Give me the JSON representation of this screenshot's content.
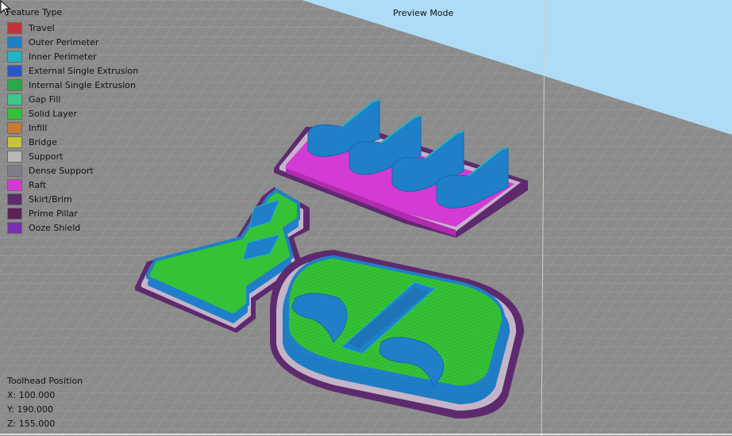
{
  "legend": {
    "title": "Feature Type",
    "items": [
      {
        "label": "Travel",
        "color": "#c2343a"
      },
      {
        "label": "Outer Perimeter",
        "color": "#1f80c9"
      },
      {
        "label": "Inner Perimeter",
        "color": "#22b3c4"
      },
      {
        "label": "External Single Extrusion",
        "color": "#2a57c8"
      },
      {
        "label": "Internal Single Extrusion",
        "color": "#2aa84a"
      },
      {
        "label": "Gap Fill",
        "color": "#3cc98e"
      },
      {
        "label": "Solid Layer",
        "color": "#35c236"
      },
      {
        "label": "Infill",
        "color": "#c57b36"
      },
      {
        "label": "Bridge",
        "color": "#c8c23a"
      },
      {
        "label": "Support",
        "color": "#b8b8b8"
      },
      {
        "label": "Dense Support",
        "color": "#7c7f83"
      },
      {
        "label": "Raft",
        "color": "#d43ad6"
      },
      {
        "label": "Skirt/Brim",
        "color": "#5e2a6e"
      },
      {
        "label": "Prime Pillar",
        "color": "#5b2254"
      },
      {
        "label": "Ooze Shield",
        "color": "#7a2fb2"
      }
    ]
  },
  "mode_label": "Preview Mode",
  "toolhead": {
    "title": "Toolhead Position",
    "x": "X: 100.000",
    "y": "Y: 190.000",
    "z": "Z: 155.000"
  },
  "colors": {
    "background": "#aedcf7",
    "bed": "#8b8b8b",
    "grid": "#a4a4a4",
    "outer_perimeter": "#1f80c9",
    "solid_layer": "#35c236",
    "inner_perimeter": "#22b3c4",
    "raft": "#d43ad6",
    "skirt": "#5e2a6e"
  }
}
